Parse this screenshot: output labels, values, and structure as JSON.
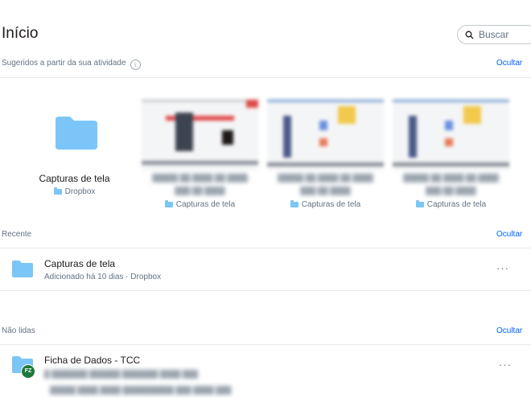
{
  "header": {
    "title": "Início",
    "search_placeholder": "Buscar"
  },
  "suggested": {
    "title": "Sugeridos a partir da sua atividade",
    "info_glyph": "i",
    "hide_label": "Ocultar",
    "folder_card": {
      "name": "Capturas de tela",
      "location": "Dropbox"
    },
    "file_cards": [
      {
        "location": "Capturas de tela"
      },
      {
        "location": "Capturas de tela"
      },
      {
        "location": "Capturas de tela"
      }
    ]
  },
  "recent": {
    "title": "Recente",
    "hide_label": "Ocultar",
    "items": [
      {
        "name": "Capturas de tela",
        "meta": "Adicionado há 10 dias · Dropbox",
        "more": "···"
      }
    ]
  },
  "unread": {
    "title": "Não lidas",
    "hide_label": "Ocultar",
    "items": [
      {
        "name": "Ficha de Dados - TCC",
        "avatar_initials": "FZ",
        "more": "···"
      }
    ]
  },
  "colors": {
    "accent": "#0061fe",
    "folder": "#7cc5f8",
    "avatar": "#1d7a3a"
  }
}
